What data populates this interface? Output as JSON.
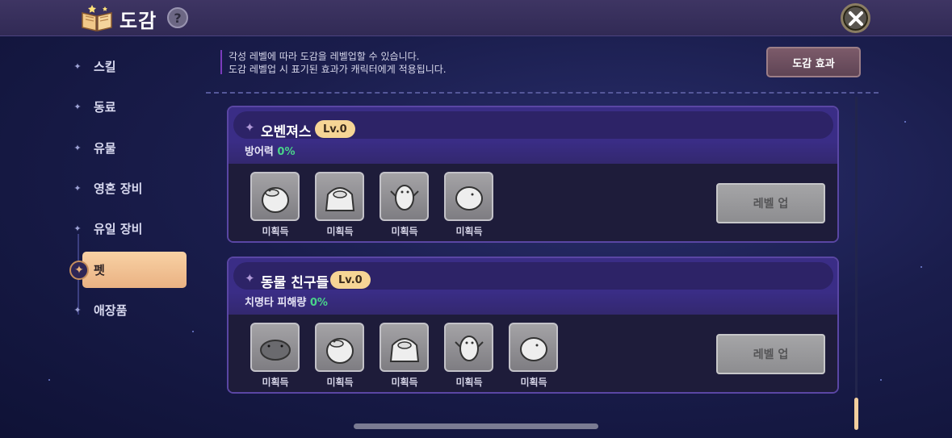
{
  "header": {
    "title": "도감",
    "help_label": "?"
  },
  "sidebar": {
    "items": [
      {
        "label": "스킬"
      },
      {
        "label": "동료"
      },
      {
        "label": "유물"
      },
      {
        "label": "영혼 장비"
      },
      {
        "label": "유일 장비"
      },
      {
        "label": "펫",
        "active": true
      },
      {
        "label": "애장품"
      }
    ]
  },
  "info": {
    "line1": "각성 레벨에 따라 도감을 레벨업할 수 있습니다.",
    "line2": "도감 레벨업 시 표기된 효과가 캐릭터에게 적용됩니다.",
    "effect_button": "도감 효과"
  },
  "collections": [
    {
      "title": "오벤져스",
      "level": "Lv.0",
      "stat_label": "방어력",
      "stat_value": "0%",
      "pets": [
        {
          "icon": "duck-pet-icon",
          "status": "미획득"
        },
        {
          "icon": "penguin-pet-icon",
          "status": "미획득"
        },
        {
          "icon": "bird-pet-icon",
          "status": "미획득"
        },
        {
          "icon": "egg-pet-icon",
          "status": "미획득"
        }
      ],
      "button": "레벨 업"
    },
    {
      "title": "동물 친구들",
      "level": "Lv.0",
      "stat_label": "치명타 피해량",
      "stat_value": "0%",
      "pets": [
        {
          "icon": "hippo-pet-icon",
          "status": "미획득"
        },
        {
          "icon": "duck-pet-icon",
          "status": "미획득"
        },
        {
          "icon": "penguin-pet-icon",
          "status": "미획득"
        },
        {
          "icon": "bird-pet-icon",
          "status": "미획득"
        },
        {
          "icon": "egg-pet-icon",
          "status": "미획득"
        }
      ],
      "button": "레벨 업"
    }
  ],
  "colors": {
    "accent": "#f6d595",
    "stat_green": "#49d48a",
    "card_border": "#5a46a4"
  }
}
